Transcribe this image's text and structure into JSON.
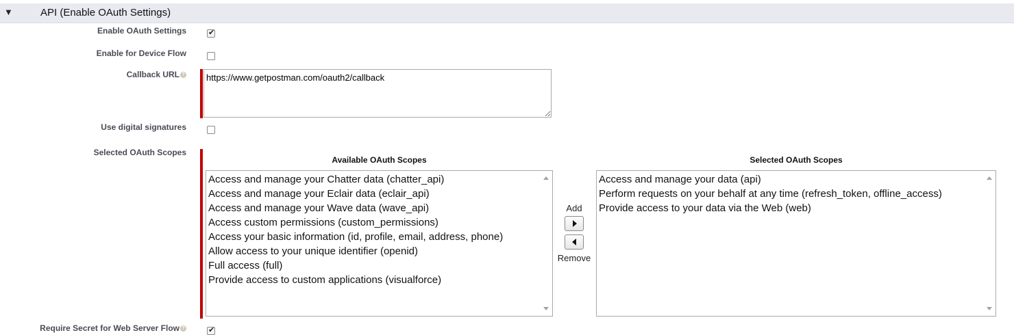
{
  "section": {
    "toggle_icon": "▼",
    "title": "API (Enable OAuth Settings)"
  },
  "fields": {
    "enable_oauth": {
      "label": "Enable OAuth Settings",
      "checked": true
    },
    "device_flow": {
      "label": "Enable for Device Flow",
      "checked": false
    },
    "callback_url": {
      "label": "Callback URL",
      "value": "https://www.getpostman.com/oauth2/callback"
    },
    "digital_signatures": {
      "label": "Use digital signatures",
      "checked": false
    },
    "selected_scopes": {
      "label": "Selected OAuth Scopes"
    },
    "require_secret": {
      "label": "Require Secret for Web Server Flow",
      "checked": true
    }
  },
  "scopes": {
    "available_title": "Available OAuth Scopes",
    "selected_title": "Selected OAuth Scopes",
    "available": [
      "Access and manage your Chatter data (chatter_api)",
      "Access and manage your Eclair data (eclair_api)",
      "Access and manage your Wave data (wave_api)",
      "Access custom permissions (custom_permissions)",
      "Access your basic information (id, profile, email, address, phone)",
      "Allow access to your unique identifier (openid)",
      "Full access (full)",
      "Provide access to custom applications (visualforce)"
    ],
    "selected": [
      "Access and manage your data (api)",
      "Perform requests on your behalf at any time (refresh_token, offline_access)",
      "Provide access to your data via the Web (web)"
    ],
    "add_label": "Add",
    "remove_label": "Remove"
  },
  "colors": {
    "required": "#c00000",
    "header_bg": "#e8eaf0",
    "label": "#4a4a56"
  },
  "icons": {
    "help": "help-icon",
    "add": "arrow-right-icon",
    "remove": "arrow-left-icon",
    "check": "checkmark-icon"
  }
}
